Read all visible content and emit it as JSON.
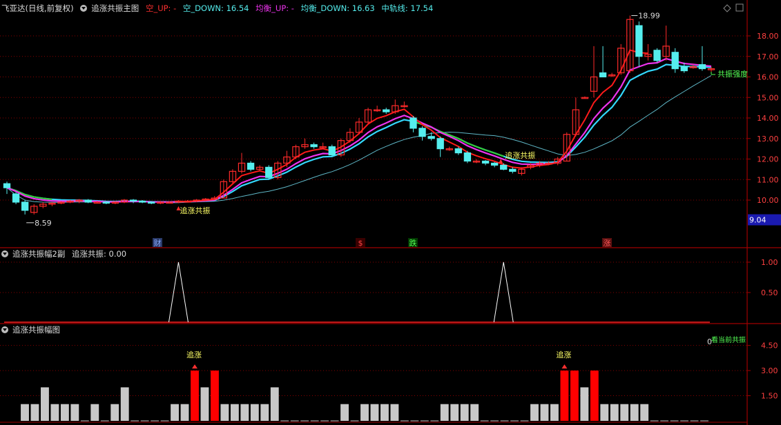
{
  "main": {
    "stock_name": "飞亚达",
    "period": "(日线,前复权)",
    "indicator": "追涨共振主图",
    "kong_up_label": "空_UP: -",
    "kong_down_label": "空_DOWN: 16.54",
    "junheng_up_label": "均衡_UP: -",
    "junheng_down_label": "均衡_DOWN: 16.63",
    "midline_label": "中轨线: 17.54",
    "high_marker": "18.99",
    "low_marker": "8.59",
    "current_price": "9.04",
    "signal_text_1": "追涨共振",
    "signal_text_2": "追涨共振",
    "right_label": "共振强度",
    "event_labels": [
      "财",
      "$",
      "跌",
      "涨"
    ],
    "yticks": [
      "18.00",
      "17.00",
      "16.00",
      "15.00",
      "14.00",
      "13.00",
      "12.00",
      "11.00",
      "10.00"
    ]
  },
  "sub1": {
    "title": "追涨共振幅2副",
    "value_label": "追涨共振: 0.00",
    "yticks": [
      "1.00",
      "0.50"
    ]
  },
  "sub2": {
    "title": "追涨共振幅图",
    "zero_label": "0",
    "trend_label": "看当前共振",
    "signal_text_1": "追涨",
    "signal_text_2": "追涨",
    "yticks": [
      "4.50",
      "3.00",
      "1.50"
    ]
  },
  "colors": {
    "up": "#ff2a2a",
    "down": "#55eeee",
    "ma_red": "#ff1a1a",
    "ma_magenta": "#ee33ee",
    "ma_cyan": "#33d9ff",
    "ma_green": "#33cc33",
    "midline": "#5fb7c7",
    "grid": "#8a0000",
    "bar_gray": "#c8c8c8",
    "bar_red": "#ff0000"
  },
  "chart_data": [
    {
      "type": "candlestick",
      "title": "追涨共振主图",
      "ylim": [
        9.3,
        18.9
      ],
      "candles": [
        [
          10.8,
          10.6,
          10.9,
          10.3
        ],
        [
          10.3,
          9.9,
          10.4,
          9.8
        ],
        [
          9.9,
          9.5,
          10.0,
          9.3
        ],
        [
          9.4,
          9.7,
          9.8,
          9.3
        ],
        [
          9.7,
          9.8,
          9.9,
          9.6
        ],
        [
          9.8,
          9.85,
          9.9,
          9.7
        ],
        [
          9.85,
          9.9,
          9.95,
          9.8
        ],
        [
          9.9,
          9.95,
          10.0,
          9.85
        ],
        [
          9.95,
          10.0,
          10.05,
          9.85
        ],
        [
          10.0,
          9.9,
          10.05,
          9.85
        ],
        [
          9.9,
          9.9,
          9.95,
          9.85
        ],
        [
          9.9,
          9.85,
          9.95,
          9.8
        ],
        [
          9.85,
          9.9,
          9.95,
          9.8
        ],
        [
          9.9,
          10.0,
          10.05,
          9.85
        ],
        [
          10.0,
          9.95,
          10.05,
          9.85
        ],
        [
          9.95,
          9.9,
          10.0,
          9.85
        ],
        [
          9.9,
          9.85,
          9.95,
          9.8
        ],
        [
          9.85,
          9.9,
          9.95,
          9.8
        ],
        [
          9.9,
          9.9,
          9.95,
          9.85
        ],
        [
          9.9,
          9.95,
          10.0,
          9.85
        ],
        [
          9.95,
          9.95,
          10.0,
          9.9
        ],
        [
          9.95,
          10.0,
          10.05,
          9.9
        ],
        [
          10.0,
          10.05,
          10.1,
          9.95
        ],
        [
          10.05,
          10.1,
          10.2,
          10.0
        ],
        [
          10.1,
          10.9,
          11.0,
          10.1
        ],
        [
          10.9,
          11.4,
          11.5,
          10.8
        ],
        [
          11.4,
          11.8,
          12.3,
          11.3
        ],
        [
          11.8,
          11.5,
          11.9,
          11.4
        ],
        [
          11.5,
          11.6,
          11.7,
          11.4
        ],
        [
          11.6,
          11.1,
          11.7,
          11.0
        ],
        [
          11.1,
          11.8,
          11.9,
          11.0
        ],
        [
          11.8,
          12.1,
          12.4,
          11.6
        ],
        [
          12.1,
          12.6,
          12.7,
          12.0
        ],
        [
          12.6,
          12.7,
          13.0,
          12.5
        ],
        [
          12.7,
          12.6,
          12.8,
          12.5
        ],
        [
          12.6,
          12.6,
          12.8,
          12.5
        ],
        [
          12.6,
          12.2,
          12.7,
          12.1
        ],
        [
          12.2,
          12.9,
          13.0,
          12.1
        ],
        [
          12.9,
          13.3,
          13.5,
          12.8
        ],
        [
          13.3,
          13.8,
          14.0,
          13.2
        ],
        [
          13.8,
          14.4,
          14.5,
          13.7
        ],
        [
          14.4,
          14.4,
          14.6,
          14.3
        ],
        [
          14.4,
          14.3,
          14.5,
          14.2
        ],
        [
          14.3,
          14.6,
          14.9,
          14.2
        ],
        [
          14.6,
          14.6,
          14.8,
          14.5
        ],
        [
          14.0,
          13.5,
          14.1,
          13.3
        ],
        [
          13.5,
          13.1,
          13.6,
          12.9
        ],
        [
          13.1,
          13.0,
          13.3,
          12.9
        ],
        [
          13.0,
          12.5,
          13.1,
          12.1
        ],
        [
          12.5,
          12.5,
          12.6,
          12.4
        ],
        [
          12.5,
          12.3,
          12.6,
          12.2
        ],
        [
          12.3,
          11.9,
          12.4,
          11.8
        ],
        [
          11.9,
          11.9,
          12.0,
          11.8
        ],
        [
          11.9,
          11.8,
          11.95,
          11.7
        ],
        [
          11.8,
          11.7,
          11.85,
          11.6
        ],
        [
          11.7,
          11.5,
          11.8,
          11.45
        ],
        [
          11.5,
          11.4,
          11.6,
          11.3
        ],
        [
          11.3,
          11.5,
          11.6,
          11.2
        ],
        [
          11.6,
          11.7,
          11.8,
          11.5
        ],
        [
          11.7,
          11.8,
          11.9,
          11.6
        ],
        [
          11.8,
          11.8,
          11.9,
          11.7
        ],
        [
          11.8,
          12.0,
          12.1,
          11.7
        ],
        [
          11.9,
          13.2,
          13.3,
          11.9
        ],
        [
          13.2,
          14.4,
          15.0,
          13.1
        ],
        [
          15.0,
          15.0,
          15.05,
          14.95
        ],
        [
          15.3,
          16.0,
          17.5,
          15.0
        ],
        [
          16.2,
          16.0,
          17.5,
          16.0
        ],
        [
          16.1,
          16.1,
          16.2,
          16.0
        ],
        [
          16.2,
          17.4,
          17.6,
          16.1
        ],
        [
          16.3,
          18.8,
          18.99,
          16.2
        ],
        [
          18.5,
          17.0,
          18.7,
          16.5
        ],
        [
          17.0,
          17.1,
          17.6,
          16.8
        ],
        [
          17.3,
          16.8,
          17.4,
          16.7
        ],
        [
          17.0,
          17.5,
          18.5,
          16.8
        ],
        [
          17.2,
          16.4,
          17.4,
          16.2
        ],
        [
          16.5,
          16.3,
          16.7,
          16.2
        ],
        [
          16.5,
          16.5,
          16.6,
          16.4
        ],
        [
          16.6,
          16.4,
          17.5,
          16.3
        ],
        [
          16.4,
          16.4,
          16.5,
          16.2
        ]
      ]
    },
    {
      "type": "line",
      "title": "追涨共振幅2副",
      "ylim": [
        0,
        1
      ],
      "series": [
        {
          "name": "追涨共振",
          "peaks_at_candles": [
            19,
            55
          ],
          "values": [
            0,
            1,
            0
          ]
        }
      ]
    },
    {
      "type": "bar",
      "title": "追涨共振幅图",
      "ylim": [
        0,
        5
      ],
      "values": [
        1,
        1,
        2,
        1,
        1,
        1,
        0,
        1,
        0,
        1,
        2,
        0,
        0,
        0,
        0,
        1,
        1,
        3,
        2,
        3,
        1,
        1,
        1,
        1,
        1,
        2,
        0,
        0,
        0,
        0,
        0,
        0,
        1,
        0,
        1,
        1,
        1,
        1,
        0,
        0,
        0,
        0,
        1,
        1,
        1,
        1,
        0,
        0,
        0,
        0,
        0,
        1,
        1,
        1,
        3,
        3,
        2,
        3,
        1,
        1,
        1,
        1,
        1,
        0,
        0,
        0,
        0,
        0,
        0
      ],
      "red_indices": [
        17,
        19,
        54,
        55,
        57
      ]
    }
  ]
}
